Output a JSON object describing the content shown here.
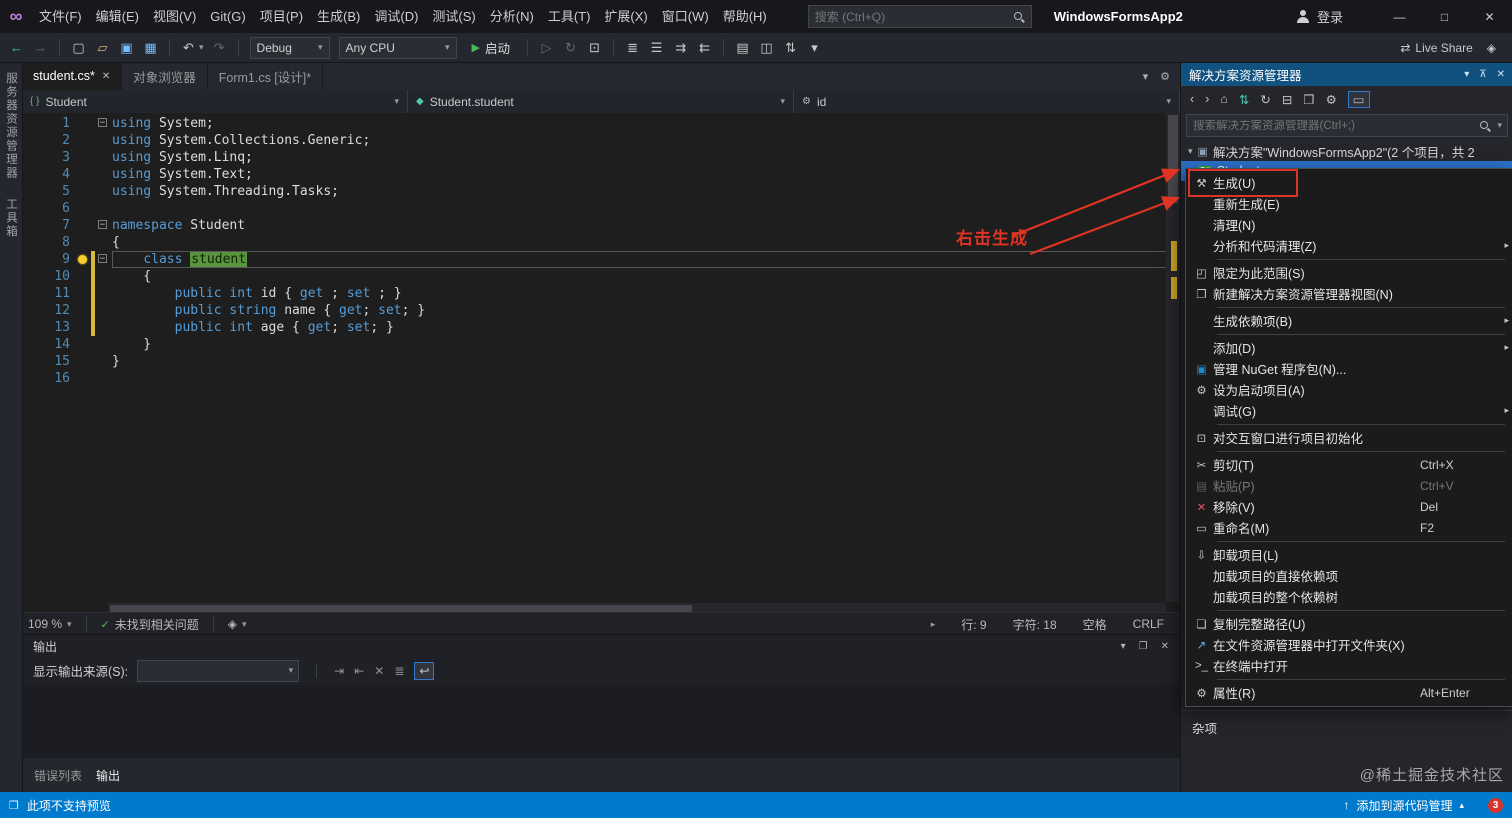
{
  "titlebar": {
    "menus": [
      "文件(F)",
      "编辑(E)",
      "视图(V)",
      "Git(G)",
      "项目(P)",
      "生成(B)",
      "调试(D)",
      "测试(S)",
      "分析(N)",
      "工具(T)",
      "扩展(X)",
      "窗口(W)",
      "帮助(H)"
    ],
    "search_placeholder": "搜索 (Ctrl+Q)",
    "app_title": "WindowsFormsApp2",
    "signin_label": "登录",
    "minimize": "—",
    "maximize": "□",
    "close": "✕"
  },
  "toolbar": {
    "items": [
      {
        "t": "icon",
        "g": "←",
        "c": "#4ec9b0",
        "name": "navigate-backward-icon"
      },
      {
        "t": "icon",
        "g": "→",
        "dim": true,
        "name": "navigate-forward-icon"
      },
      {
        "t": "sep"
      },
      {
        "t": "icon",
        "g": "▢",
        "name": "new-project-icon"
      },
      {
        "t": "icon",
        "g": "▱",
        "c": "#dcb67a",
        "name": "open-folder-icon"
      },
      {
        "t": "icon",
        "g": "▣",
        "c": "#75beff",
        "name": "save-icon"
      },
      {
        "t": "icon",
        "g": "▦",
        "c": "#75beff",
        "name": "save-all-icon"
      },
      {
        "t": "sep"
      },
      {
        "t": "icon",
        "g": "↶",
        "dd": true,
        "name": "undo-icon"
      },
      {
        "t": "icon",
        "g": "↷",
        "dim": true,
        "name": "redo-icon"
      },
      {
        "t": "sep"
      },
      {
        "t": "combo",
        "label": "Debug",
        "w": 66,
        "name": "configuration-dropdown"
      },
      {
        "t": "combo",
        "label": "Any CPU",
        "w": 104,
        "name": "platform-dropdown"
      },
      {
        "t": "start"
      },
      {
        "t": "sep"
      },
      {
        "t": "icon",
        "g": "▷",
        "dim": true,
        "name": "run-without-debug-icon"
      },
      {
        "t": "icon",
        "g": "↻",
        "dim": true,
        "name": "refresh-icon"
      },
      {
        "t": "icon",
        "g": "⊡",
        "name": "breakpoint-icon"
      },
      {
        "t": "sep"
      },
      {
        "t": "icon",
        "g": "≣",
        "name": "outline-icon"
      },
      {
        "t": "icon",
        "g": "☰",
        "name": "list-icon"
      },
      {
        "t": "icon",
        "g": "⇉",
        "name": "indent-icon"
      },
      {
        "t": "icon",
        "g": "⇇",
        "name": "outdent-icon"
      },
      {
        "t": "sep"
      },
      {
        "t": "icon",
        "g": "▤",
        "name": "comment-icon"
      },
      {
        "t": "icon",
        "g": "◫",
        "name": "uncomment-icon"
      },
      {
        "t": "icon",
        "g": "⇅",
        "name": "sort-icon"
      },
      {
        "t": "icon",
        "g": "▾",
        "name": "more-options-icon"
      }
    ],
    "start_label": "启动",
    "right_items": [
      {
        "g": "⇄",
        "label": "Live Share",
        "name": "live-share-button"
      },
      {
        "g": "◈",
        "name": "feedback-icon"
      }
    ]
  },
  "tabs": {
    "close_glyph": "✕",
    "items": [
      {
        "label": "student.cs*",
        "active": true
      },
      {
        "label": "对象浏览器",
        "active": false
      },
      {
        "label": "Form1.cs [设计]*",
        "active": false
      }
    ],
    "right_icons": [
      {
        "g": "▾",
        "name": "active-files-dropdown-icon"
      },
      {
        "g": "⚙",
        "name": "editor-options-icon"
      }
    ]
  },
  "navbar": {
    "caret": "▾",
    "segments": [
      {
        "icon": "{ }",
        "icon_color": "#6fb06f",
        "label": "Student",
        "icon_name": "project-icon"
      },
      {
        "icon": "◆",
        "icon_color": "#4ec9b0",
        "label": "Student.student",
        "icon_name": "class-icon"
      },
      {
        "icon": "⚙",
        "icon_color": "#b8b8b8",
        "label": "id",
        "icon_name": "member-icon"
      }
    ]
  },
  "editor": {
    "annotation": "右击生成",
    "lines": [
      {
        "n": 1,
        "fold": true,
        "t": [
          [
            "kw",
            "using"
          ],
          [
            "pl",
            " System;"
          ]
        ]
      },
      {
        "n": 2,
        "t": [
          [
            "kw",
            "using"
          ],
          [
            "pl",
            " System.Collections.Generic;"
          ]
        ]
      },
      {
        "n": 3,
        "t": [
          [
            "kw",
            "using"
          ],
          [
            "pl",
            " System.Linq;"
          ]
        ]
      },
      {
        "n": 4,
        "t": [
          [
            "kw",
            "using"
          ],
          [
            "pl",
            " System.Text;"
          ]
        ]
      },
      {
        "n": 5,
        "t": [
          [
            "kw",
            "using"
          ],
          [
            "pl",
            " System.Threading.Tasks;"
          ]
        ]
      },
      {
        "n": 6,
        "t": []
      },
      {
        "n": 7,
        "fold": true,
        "t": [
          [
            "kw",
            "namespace"
          ],
          [
            "pl",
            " Student"
          ]
        ]
      },
      {
        "n": 8,
        "t": [
          [
            "pl",
            "{"
          ]
        ]
      },
      {
        "n": 9,
        "fold": true,
        "bulb": true,
        "changed": true,
        "current": true,
        "t": [
          [
            "pl",
            "    "
          ],
          [
            "kw",
            "class"
          ],
          [
            "pl",
            " "
          ],
          [
            "sel",
            "student"
          ]
        ]
      },
      {
        "n": 10,
        "changed": true,
        "t": [
          [
            "pl",
            "    {"
          ]
        ]
      },
      {
        "n": 11,
        "changed": true,
        "t": [
          [
            "pl",
            "        "
          ],
          [
            "kw",
            "public"
          ],
          [
            "pl",
            " "
          ],
          [
            "kw",
            "int"
          ],
          [
            "pl",
            " id { "
          ],
          [
            "kw",
            "get"
          ],
          [
            "pl",
            " ; "
          ],
          [
            "kw",
            "set"
          ],
          [
            "pl",
            " ; }"
          ]
        ]
      },
      {
        "n": 12,
        "changed": true,
        "t": [
          [
            "pl",
            "        "
          ],
          [
            "kw",
            "public"
          ],
          [
            "pl",
            " "
          ],
          [
            "kw",
            "string"
          ],
          [
            "pl",
            " name { "
          ],
          [
            "kw",
            "get"
          ],
          [
            "pl",
            "; "
          ],
          [
            "kw",
            "set"
          ],
          [
            "pl",
            "; }"
          ]
        ]
      },
      {
        "n": 13,
        "changed": true,
        "t": [
          [
            "pl",
            "        "
          ],
          [
            "kw",
            "public"
          ],
          [
            "pl",
            " "
          ],
          [
            "kw",
            "int"
          ],
          [
            "pl",
            " age { "
          ],
          [
            "kw",
            "get"
          ],
          [
            "pl",
            "; "
          ],
          [
            "kw",
            "set"
          ],
          [
            "pl",
            "; }"
          ]
        ]
      },
      {
        "n": 14,
        "t": [
          [
            "pl",
            "    }"
          ]
        ]
      },
      {
        "n": 15,
        "t": [
          [
            "pl",
            "}"
          ]
        ]
      },
      {
        "n": 16,
        "t": []
      }
    ]
  },
  "editor_statusbar": {
    "zoom": "109 %",
    "health_label": "未找到相关问题",
    "line": "行: 9",
    "column": "字符: 18",
    "spaces": "空格",
    "line_ending": "CRLF"
  },
  "output_panel": {
    "title": "输出",
    "source_label": "显示输出来源(S):",
    "header_icons": [
      {
        "g": "▾",
        "name": "chevron-down-icon"
      },
      {
        "g": "❐",
        "name": "restore-icon"
      },
      {
        "g": "✕",
        "name": "close-icon"
      }
    ],
    "toolbar_icons": [
      {
        "g": "⇥",
        "name": "goto-message-icon"
      },
      {
        "g": "⇤",
        "name": "previous-message-icon"
      },
      {
        "g": "✕",
        "name": "clear-all-icon"
      },
      {
        "g": "≣",
        "name": "toggle-lines-icon"
      },
      {
        "g": "↩",
        "boxed": true,
        "name": "word-wrap-icon"
      }
    ]
  },
  "bottom_tabs": [
    {
      "label": "错误列表",
      "active": false
    },
    {
      "label": "输出",
      "active": true
    }
  ],
  "left_sidebar": [
    "服务器资源管理器",
    "工具箱"
  ],
  "solution_explorer": {
    "title": "解决方案资源管理器",
    "title_icons": [
      "▾",
      "⊼",
      "✕"
    ],
    "toolbar_icons": [
      {
        "g": "‹",
        "name": "back-icon"
      },
      {
        "g": "›",
        "name": "forward-icon"
      },
      {
        "g": "⌂",
        "name": "home-icon"
      },
      {
        "g": "⇅",
        "c": "#4ec9b0",
        "name": "sync-with-active-document-icon"
      },
      {
        "g": "↻",
        "name": "refresh-icon"
      },
      {
        "g": "⊟",
        "name": "collapse-all-icon"
      },
      {
        "g": "❐",
        "name": "preview-icon"
      },
      {
        "g": "⚙",
        "name": "properties-icon"
      },
      {
        "g": "▭",
        "boxed": true,
        "name": "show-all-files-icon"
      }
    ],
    "search_placeholder": "搜索解决方案资源管理器(Ctrl+;)",
    "root_item": "解决方案\"WindowsFormsApp2\"(2 个项目，共 2",
    "selected_item": "Student",
    "misc_header": "杂项"
  },
  "context_menu": {
    "items": [
      {
        "label": "生成(U)",
        "icon": "⚒",
        "annotated": true
      },
      {
        "label": "重新生成(E)"
      },
      {
        "label": "清理(N)"
      },
      {
        "label": "分析和代码清理(Z)",
        "submenu": true,
        "sep": true
      },
      {
        "label": "限定为此范围(S)",
        "icon": "◰"
      },
      {
        "label": "新建解决方案资源管理器视图(N)",
        "icon": "❐",
        "sep": true
      },
      {
        "label": "生成依赖项(B)",
        "submenu": true,
        "sep": true
      },
      {
        "label": "添加(D)",
        "submenu": true
      },
      {
        "label": "管理 NuGet 程序包(N)...",
        "icon": "▣",
        "icon_color": "#1c87c9"
      },
      {
        "label": "设为启动项目(A)",
        "icon": "⚙"
      },
      {
        "label": "调试(G)",
        "submenu": true,
        "sep": true
      },
      {
        "label": "对交互窗口进行项目初始化",
        "icon": "⊡",
        "sep": true
      },
      {
        "label": "剪切(T)",
        "icon": "✂",
        "shortcut": "Ctrl+X"
      },
      {
        "label": "粘贴(P)",
        "icon": "▤",
        "shortcut": "Ctrl+V",
        "disabled": true
      },
      {
        "label": "移除(V)",
        "icon": "✕",
        "icon_color": "#e05561",
        "shortcut": "Del"
      },
      {
        "label": "重命名(M)",
        "icon": "▭",
        "shortcut": "F2",
        "sep": true
      },
      {
        "label": "卸载项目(L)",
        "icon": "⇩"
      },
      {
        "label": "加载项目的直接依赖项"
      },
      {
        "label": "加载项目的整个依赖树",
        "sep": true
      },
      {
        "label": "复制完整路径(U)",
        "icon": "❏"
      },
      {
        "label": "在文件资源管理器中打开文件夹(X)",
        "icon": "↗",
        "icon_color": "#5fb2f2"
      },
      {
        "label": "在终端中打开",
        "icon": ">_",
        "sep": true
      },
      {
        "label": "属性(R)",
        "icon": "⚙",
        "shortcut": "Alt+Enter"
      }
    ]
  },
  "statusbar": {
    "message": "此项不支持预览",
    "source_control": "添加到源代码管理",
    "badge_count": "3"
  },
  "icons": {
    "solution": "▣",
    "preview": "❐",
    "check": "✓",
    "diamond": "◈",
    "upload": "↑"
  },
  "watermark": "@稀土掘金技术社区"
}
